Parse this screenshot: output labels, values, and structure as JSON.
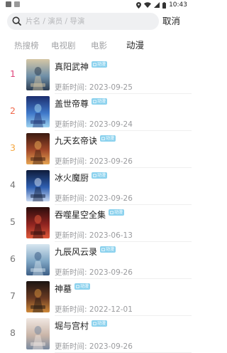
{
  "status_bar": {
    "time": "10:43",
    "icons": [
      "gallery-icon",
      "app-icon",
      "location-icon",
      "wifi-icon",
      "signal-icon",
      "battery-icon"
    ]
  },
  "search": {
    "placeholder": "片名 / 演员 / 导演",
    "value": "",
    "cancel_label": "取消"
  },
  "tabs": [
    {
      "label": "热搜榜",
      "active": false
    },
    {
      "label": "电视剧",
      "active": false
    },
    {
      "label": "电影",
      "active": false
    },
    {
      "label": "动漫",
      "active": true
    }
  ],
  "rank_colors": {
    "1": "#e0457b",
    "2": "#f06a4d",
    "3": "#f5a740",
    "default": "#777777"
  },
  "badge_color": "#8cd2ee",
  "list": [
    {
      "rank": "1",
      "title": "真阳武神",
      "badge": "动漫",
      "update_label": "更新时间:",
      "date": "2023-09-25",
      "poster_colors": [
        "#d6c7a6",
        "#6f8fa8",
        "#2e3f53"
      ]
    },
    {
      "rank": "2",
      "title": "盖世帝尊",
      "badge": "动漫",
      "update_label": "更新时间:",
      "date": "2023-09-24",
      "poster_colors": [
        "#1c2e6e",
        "#3f78c9",
        "#9fd3f0"
      ]
    },
    {
      "rank": "3",
      "title": "九天玄帝诀",
      "badge": "动漫",
      "update_label": "更新时间:",
      "date": "2023-09-26",
      "poster_colors": [
        "#3a1a10",
        "#a2492a",
        "#e7a553"
      ]
    },
    {
      "rank": "4",
      "title": "冰火魔厨",
      "badge": "动漫",
      "update_label": "更新时间:",
      "date": "2023-09-26",
      "poster_colors": [
        "#0e1b3a",
        "#2f5fb0",
        "#c9d9f2"
      ]
    },
    {
      "rank": "5",
      "title": "吞噬星空全集",
      "badge": "动漫",
      "update_label": "更新时间:",
      "date": "2023-06-13",
      "poster_colors": [
        "#2a0c0c",
        "#8f2420",
        "#e05a3a"
      ]
    },
    {
      "rank": "6",
      "title": "九辰风云录",
      "badge": "动漫",
      "update_label": "更新时间:",
      "date": "2023-09-26",
      "poster_colors": [
        "#d7e6f0",
        "#7fa6c4",
        "#3d5f86"
      ]
    },
    {
      "rank": "7",
      "title": "神墓",
      "badge": "动漫",
      "update_label": "更新时间:",
      "date": "2022-12-01",
      "poster_colors": [
        "#1b1412",
        "#6a3a22",
        "#d08a3a"
      ]
    },
    {
      "rank": "8",
      "title": "堀与宫村",
      "badge": "动漫",
      "update_label": "更新时间:",
      "date": "2023-09-26",
      "poster_colors": [
        "#f1e8e2",
        "#c9b5a8",
        "#7a8aa0"
      ]
    }
  ]
}
